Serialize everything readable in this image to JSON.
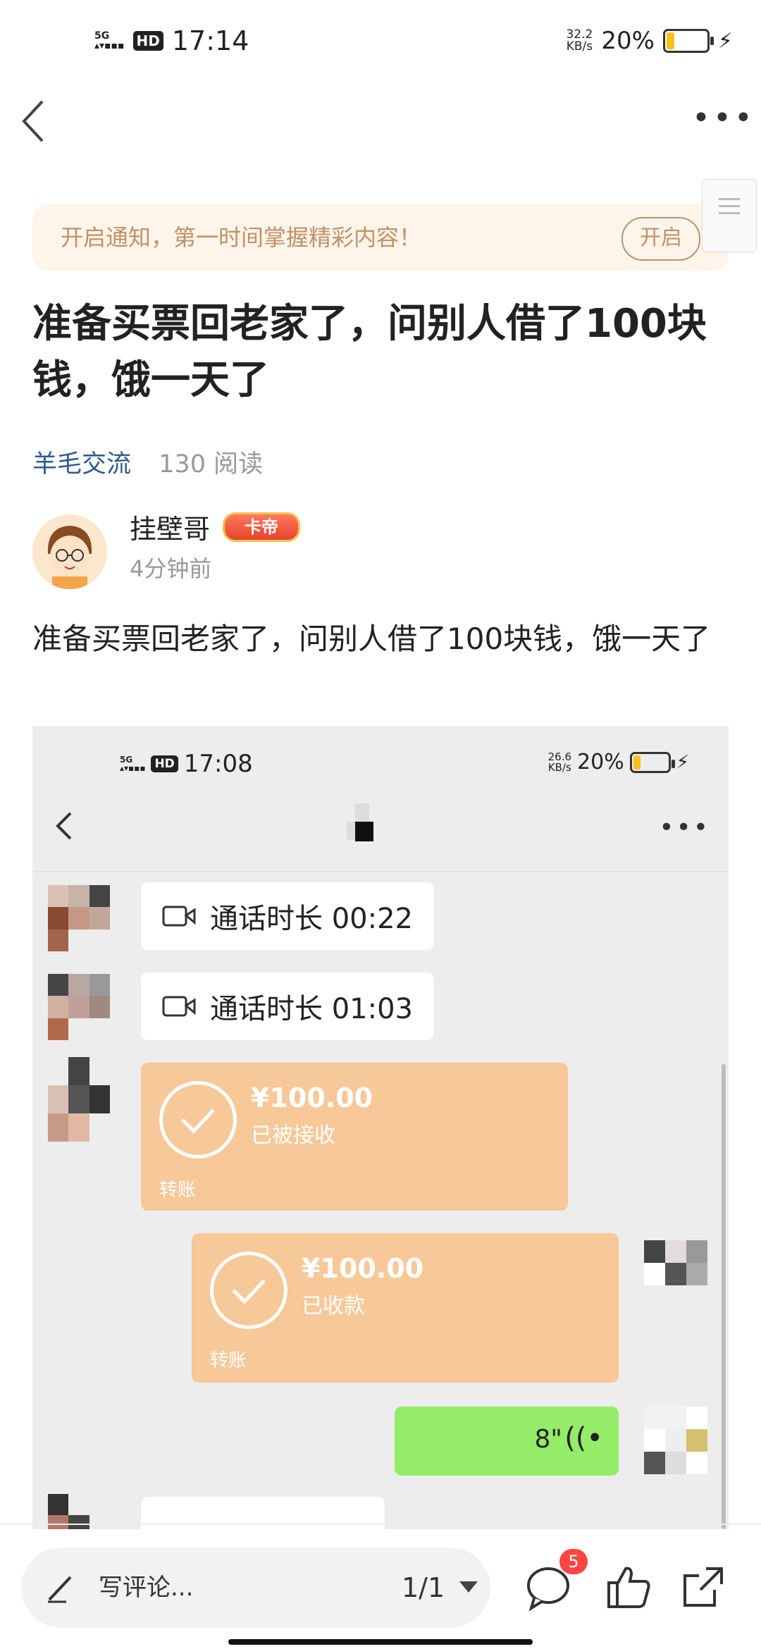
{
  "status_bar": {
    "signal": "5G",
    "hd": "HD",
    "time": "17:14",
    "speed_value": "32.2",
    "speed_unit": "KB/s",
    "battery": "20%",
    "battery_level": 0.2
  },
  "notice": {
    "text": "开启通知，第一时间掌握精彩内容！",
    "button": "开启"
  },
  "post": {
    "title": "准备买票回老家了，问别人借了100块钱，饿一天了",
    "category": "羊毛交流",
    "reads": "130 阅读",
    "author": "挂壁哥",
    "badge": "卡帝",
    "time": "4分钟前",
    "body": "准备买票回老家了，问别人借了100块钱，饿一天了"
  },
  "screenshot": {
    "status": {
      "signal": "5G",
      "hd": "HD",
      "time": "17:08",
      "speed_value": "26.6",
      "speed_unit": "KB/s",
      "battery": "20%"
    },
    "messages": [
      {
        "type": "video_call",
        "text": "通话时长 00:22"
      },
      {
        "type": "video_call",
        "text": "通话时长 01:03"
      },
      {
        "type": "transfer_received",
        "amount": "¥100.00",
        "status": "已被接收",
        "label": "转账"
      },
      {
        "type": "transfer_sent",
        "amount": "¥100.00",
        "status": "已收款",
        "label": "转账"
      },
      {
        "type": "voice",
        "duration": "8\""
      }
    ]
  },
  "bottom_bar": {
    "comment_placeholder": "写评论...",
    "pager": "1/1",
    "comment_count": "5"
  },
  "colors": {
    "accent_brown": "#c09268",
    "link_blue": "#2d5a8f",
    "transfer_orange": "#f7c898",
    "voice_green": "#95ec69",
    "badge_red": "#f44444"
  }
}
